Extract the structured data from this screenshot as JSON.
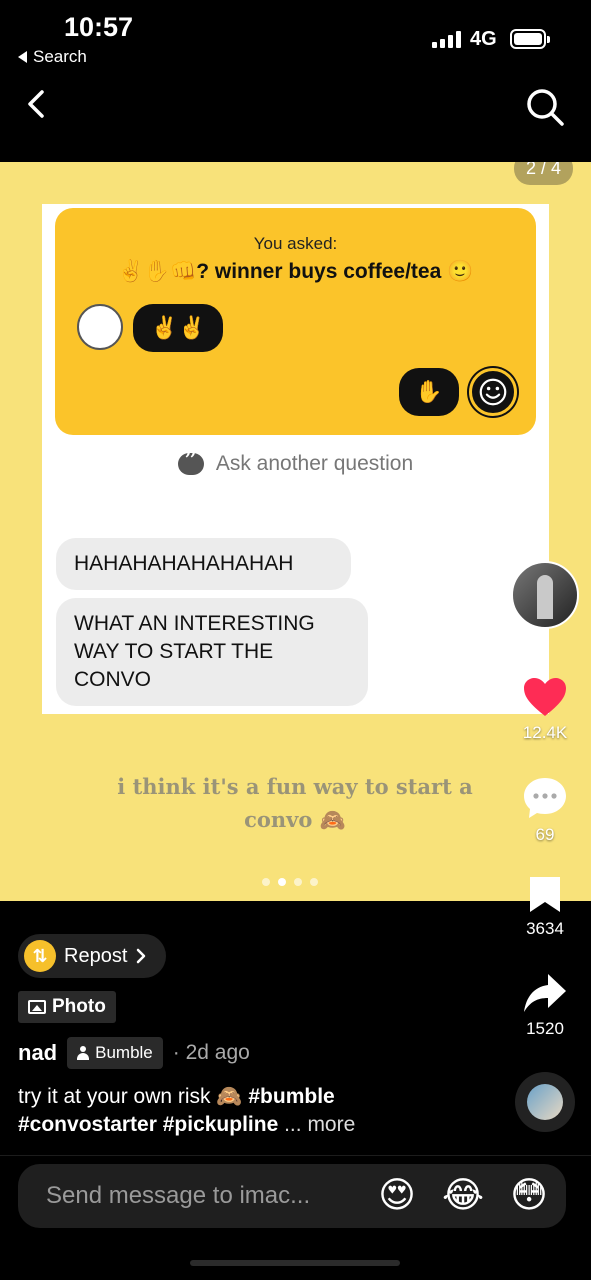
{
  "status_bar": {
    "time": "10:57",
    "back_label": "Search",
    "network": "4G"
  },
  "post": {
    "page_counter": "2 / 4",
    "screenshot": {
      "you_asked": "You asked:",
      "question": "✌️✋👊? winner buys coffee/tea 🙂",
      "their_answer": "✌️✌️",
      "my_answer": "✋",
      "ask_another": "Ask another question",
      "messages": [
        "HAHAHAHAHAHAHAH",
        "WHAT AN INTERESTING WAY TO START THE CONVO"
      ]
    },
    "caption": "i think it's a fun way to start a convo 🙈",
    "carousel": {
      "count": 4,
      "active_index": 1
    }
  },
  "actions": {
    "likes": "12.4K",
    "comments": "69",
    "bookmarks": "3634",
    "shares": "1520",
    "colors": {
      "like": "#fe2c55",
      "accent_yellow": "#f6c02b"
    }
  },
  "info": {
    "repost_label": "Repost",
    "photo_label": "Photo",
    "author": "nad",
    "label_badge": "Bumble",
    "time_ago": "· 2d ago",
    "description_text": "try it at your own risk 🙈 ",
    "description_tags": "#bumble #convostarter #pickupline",
    "more_label": " ... more"
  },
  "message_bar": {
    "placeholder": "Send message to imac...",
    "emojis": [
      "😍",
      "😂",
      "😳"
    ]
  }
}
